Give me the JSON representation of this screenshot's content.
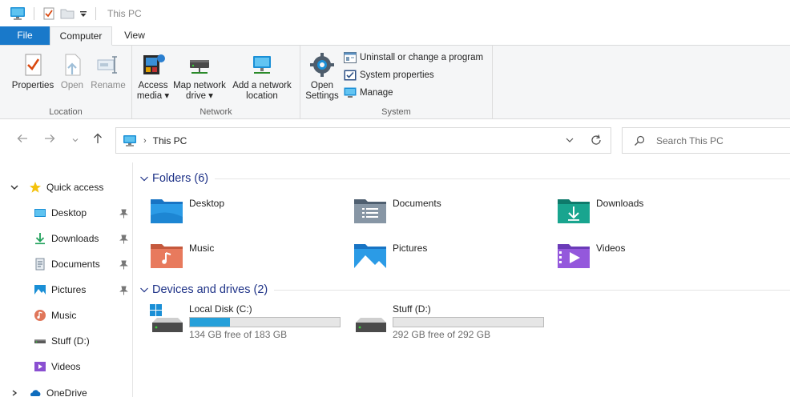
{
  "window": {
    "title": "This PC"
  },
  "ribbon_tabs": {
    "file": "File",
    "computer": "Computer",
    "view": "View"
  },
  "ribbon": {
    "location": {
      "label": "Location",
      "properties": "Properties",
      "open": "Open",
      "rename": "Rename"
    },
    "network": {
      "label": "Network",
      "access_media_1": "Access",
      "access_media_2": "media",
      "map_drive_1": "Map network",
      "map_drive_2": "drive",
      "add_location_1": "Add a network",
      "add_location_2": "location"
    },
    "system": {
      "label": "System",
      "open_settings_1": "Open",
      "open_settings_2": "Settings",
      "uninstall": "Uninstall or change a program",
      "system_properties": "System properties",
      "manage": "Manage"
    }
  },
  "address": {
    "crumb": "This PC"
  },
  "search": {
    "placeholder": "Search This PC"
  },
  "sidebar": {
    "quick_access": "Quick access",
    "items": [
      {
        "label": "Desktop",
        "icon": "desktop-icon",
        "pinned": true
      },
      {
        "label": "Downloads",
        "icon": "download-icon",
        "pinned": true
      },
      {
        "label": "Documents",
        "icon": "document-icon",
        "pinned": true
      },
      {
        "label": "Pictures",
        "icon": "pictures-icon",
        "pinned": true
      },
      {
        "label": "Music",
        "icon": "music-icon",
        "pinned": false
      },
      {
        "label": "Stuff (D:)",
        "icon": "drive-icon",
        "pinned": false
      },
      {
        "label": "Videos",
        "icon": "videos-icon",
        "pinned": false
      }
    ],
    "onedrive_partial": "OneDrive"
  },
  "folders": {
    "title": "Folders (6)",
    "items": [
      {
        "label": "Desktop",
        "icon": "desktop-folder-icon"
      },
      {
        "label": "Documents",
        "icon": "documents-folder-icon"
      },
      {
        "label": "Downloads",
        "icon": "downloads-folder-icon"
      },
      {
        "label": "Music",
        "icon": "music-folder-icon"
      },
      {
        "label": "Pictures",
        "icon": "pictures-folder-icon"
      },
      {
        "label": "Videos",
        "icon": "videos-folder-icon"
      }
    ]
  },
  "drives": {
    "title": "Devices and drives (2)",
    "items": [
      {
        "label": "Local Disk (C:)",
        "free": "134 GB free of 183 GB",
        "used_fraction": 0.27,
        "icon": "windows-drive-icon"
      },
      {
        "label": "Stuff (D:)",
        "free": "292 GB free of 292 GB",
        "used_fraction": 0.0,
        "icon": "drive-icon"
      }
    ]
  },
  "colors": {
    "accent": "#1979ca",
    "section_title": "#1e3287",
    "drive_bar": "#26a0da",
    "ribbon_bg": "#f5f6f7"
  }
}
